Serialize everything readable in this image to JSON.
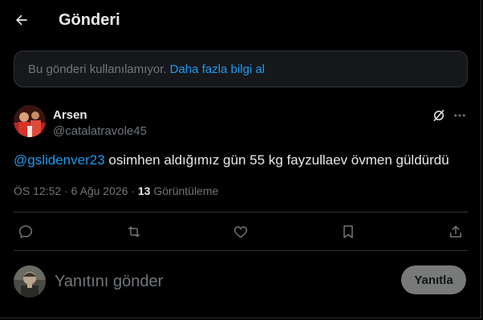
{
  "header": {
    "title": "Gönderi",
    "back_icon": "arrow-left-icon"
  },
  "notice": {
    "text": "Bu gönderi kullanılamıyor.",
    "link": "Daha fazla bilgi al"
  },
  "tweet": {
    "author_name": "Arsen",
    "author_handle": "@catalatravole45",
    "mention": "@gslidenver23",
    "text": " osimhen aldığımız gün 55 kg fayzullaev övmen güldürdü",
    "time": "ÖS 12:52 · 6 Ağu 2026 · ",
    "views_count": "13",
    "views_label": " Görüntüleme"
  },
  "actions": {
    "reply_icon": "reply-icon",
    "retweet_icon": "retweet-icon",
    "like_icon": "heart-icon",
    "bookmark_icon": "bookmark-icon",
    "share_icon": "share-icon"
  },
  "reply": {
    "placeholder": "Yanıtını gönder",
    "button_label": "Yanıtla"
  },
  "colors": {
    "background": "#000000",
    "text": "#e7e9ea",
    "muted": "#71767b",
    "accent": "#1d9bf0",
    "border": "#2f3336",
    "reply_button": "#787a7a"
  }
}
